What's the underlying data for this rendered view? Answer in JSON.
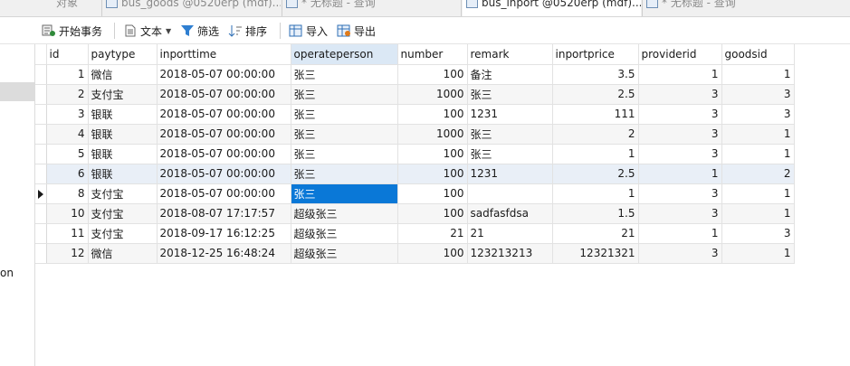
{
  "tabs": [
    {
      "label": "对象"
    },
    {
      "label": "bus_goods @0520erp (mdf)..."
    },
    {
      "label": "* 无标题 - 查询"
    },
    {
      "label": "bus_inport @0520erp (mdf)..."
    },
    {
      "label": "* 无标题 - 查询"
    }
  ],
  "toolbar": {
    "begin_transaction": "开始事务",
    "text": "文本",
    "filter": "筛选",
    "sort": "排序",
    "import": "导入",
    "export": "导出"
  },
  "leftpane": {
    "fragment": "on"
  },
  "table": {
    "columns": [
      "id",
      "paytype",
      "inporttime",
      "operateperson",
      "number",
      "remark",
      "inportprice",
      "providerid",
      "goodsid"
    ],
    "rows": [
      [
        "1",
        "微信",
        "2018-05-07 00:00:00",
        "张三",
        "100",
        "备注",
        "3.5",
        "1",
        "1"
      ],
      [
        "2",
        "支付宝",
        "2018-05-07 00:00:00",
        "张三",
        "1000",
        "张三",
        "2.5",
        "3",
        "3"
      ],
      [
        "3",
        "银联",
        "2018-05-07 00:00:00",
        "张三",
        "100",
        "1231",
        "111",
        "3",
        "3"
      ],
      [
        "4",
        "银联",
        "2018-05-07 00:00:00",
        "张三",
        "1000",
        "张三",
        "2",
        "3",
        "1"
      ],
      [
        "5",
        "银联",
        "2018-05-07 00:00:00",
        "张三",
        "100",
        "张三",
        "1",
        "3",
        "1"
      ],
      [
        "6",
        "银联",
        "2018-05-07 00:00:00",
        "张三",
        "100",
        "1231",
        "2.5",
        "1",
        "2"
      ],
      [
        "8",
        "支付宝",
        "2018-05-07 00:00:00",
        "张三",
        "100",
        "",
        "1",
        "3",
        "1"
      ],
      [
        "10",
        "支付宝",
        "2018-08-07 17:17:57",
        "超级张三",
        "100",
        "sadfasfdsa",
        "1.5",
        "3",
        "1"
      ],
      [
        "11",
        "支付宝",
        "2018-09-17 16:12:25",
        "超级张三",
        "21",
        "21",
        "21",
        "1",
        "3"
      ],
      [
        "12",
        "微信",
        "2018-12-25 16:48:24",
        "超级张三",
        "100",
        "123213213",
        "12321321",
        "3",
        "1"
      ]
    ]
  }
}
